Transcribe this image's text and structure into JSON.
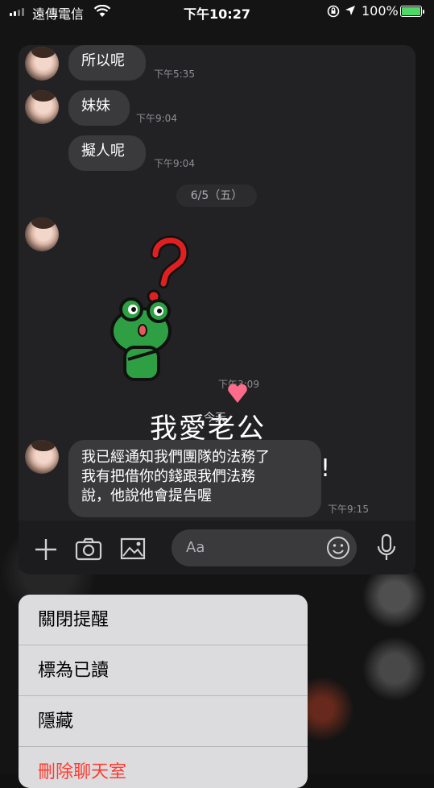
{
  "status_bar": {
    "carrier": "遠傳電信",
    "time": "下午10:27",
    "battery": "100%"
  },
  "chat": {
    "messages": [
      {
        "text": "所以呢",
        "time": "下午5:35"
      },
      {
        "text": "妹妹",
        "time": "下午9:04"
      },
      {
        "text": "擬人呢",
        "time": "下午9:04"
      }
    ],
    "date_separator": "6/5（五）",
    "sticker_time": "下午3:09",
    "overlay_text": "我愛老公",
    "today_label": "今天",
    "exclamation": "!",
    "last_message": {
      "lines": [
        "我已經通知我們團隊的法務了",
        "我有把借你的錢跟我們法務",
        "說，他說他會提告喔"
      ],
      "time": "下午9:15"
    }
  },
  "input_bar": {
    "placeholder": "Aa",
    "icons": [
      "plus-icon",
      "camera-icon",
      "image-icon",
      "emoji-icon",
      "microphone-icon"
    ]
  },
  "context_menu": {
    "items": [
      "關閉提醒",
      "標為已讀",
      "隱藏",
      "刪除聊天室"
    ]
  },
  "colors": {
    "accent_battery": "#4cd964",
    "danger": "#ff3b30",
    "bubble": "#3a3a3c"
  }
}
